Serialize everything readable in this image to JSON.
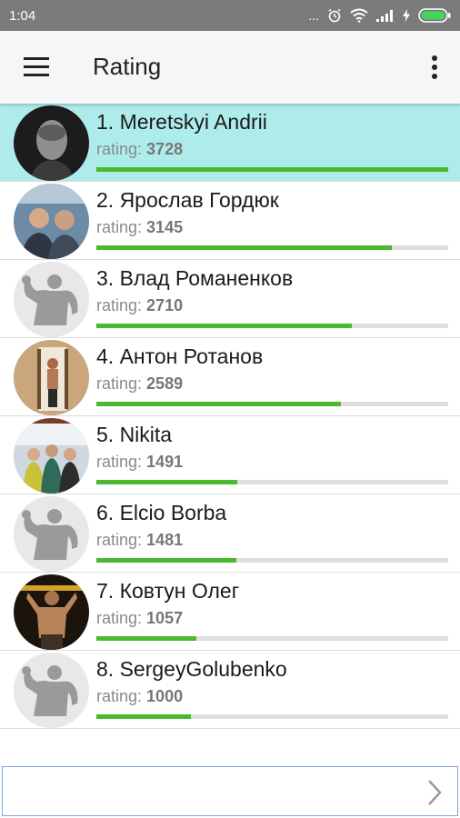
{
  "status": {
    "time": "1:04",
    "dots": "..."
  },
  "appbar": {
    "title": "Rating"
  },
  "list": [
    {
      "name": "1. Meretskyi Andrii",
      "rating_label": "rating:",
      "rating_value": "3728",
      "progress": 1.0,
      "avatar": "photo-portrait",
      "highlighted": true
    },
    {
      "name": "2. Ярослав Гордюк",
      "rating_label": "rating:",
      "rating_value": "3145",
      "progress": 0.84,
      "avatar": "photo-two-people",
      "highlighted": false
    },
    {
      "name": "3. Влад Романенков",
      "rating_label": "rating:",
      "rating_value": "2710",
      "progress": 0.727,
      "avatar": "default-bodybuilder",
      "highlighted": false
    },
    {
      "name": "4. Антон Ротанов",
      "rating_label": "rating:",
      "rating_value": "2589",
      "progress": 0.694,
      "avatar": "photo-gym",
      "highlighted": false
    },
    {
      "name": "5. Nikita",
      "rating_label": "rating:",
      "rating_value": "1491",
      "progress": 0.4,
      "avatar": "photo-group",
      "highlighted": false
    },
    {
      "name": "6. Elcio Borba",
      "rating_label": "rating:",
      "rating_value": "1481",
      "progress": 0.397,
      "avatar": "default-bodybuilder",
      "highlighted": false
    },
    {
      "name": "7. Ковтун Олег",
      "rating_label": "rating:",
      "rating_value": "1057",
      "progress": 0.284,
      "avatar": "photo-athlete",
      "highlighted": false
    },
    {
      "name": "8. SergeyGolubenko",
      "rating_label": "rating:",
      "rating_value": "1000",
      "progress": 0.268,
      "avatar": "default-bodybuilder",
      "highlighted": false
    }
  ],
  "colors": {
    "highlight": "#aeecec",
    "progress": "#4cb72f",
    "track": "#dedede",
    "statusbar": "#7b7b7b"
  }
}
